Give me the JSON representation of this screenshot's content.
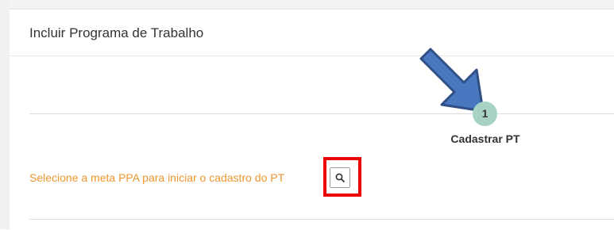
{
  "panel": {
    "title": "Incluir Programa de Trabalho"
  },
  "stepper": {
    "steps": [
      {
        "number": "1",
        "label": "Cadastrar PT"
      }
    ]
  },
  "meta_selection": {
    "prompt": "Selecione a meta PPA para iniciar o cadastro do PT",
    "search_icon": "search-icon"
  },
  "colors": {
    "prompt_text": "#f0962e",
    "step_circle": "#a8d3c3",
    "arrow_fill": "#4a78c0",
    "arrow_stroke": "#2f4f86",
    "highlight_border": "#ee0000"
  }
}
